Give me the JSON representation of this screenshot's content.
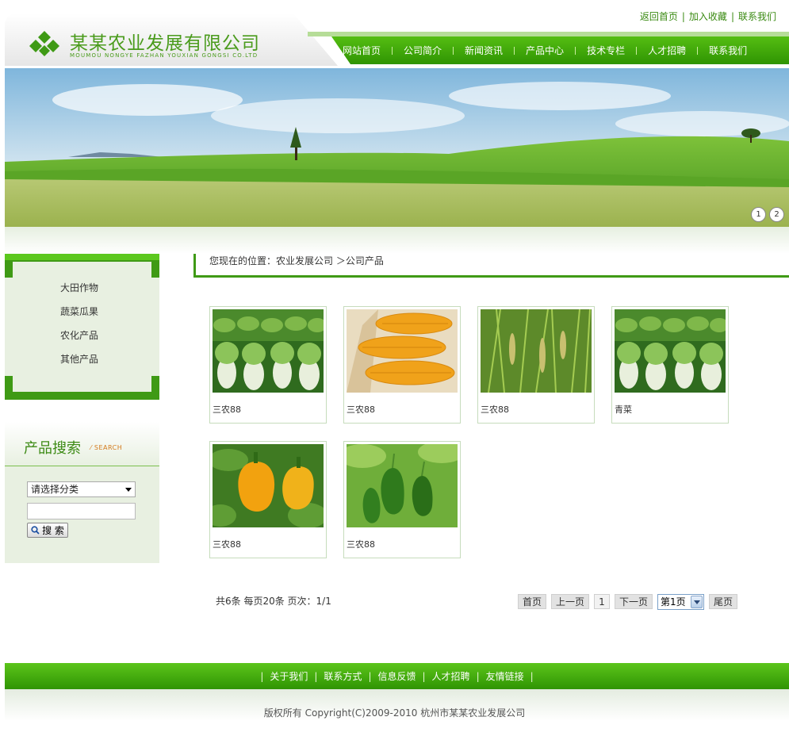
{
  "top_links": [
    "返回首页",
    "加入收藏",
    "联系我们"
  ],
  "logo": {
    "title": "某某农业发展有限公司",
    "subtitle": "MOUMOU NONGYE FAZHAN YOUXIAN GONGSI CO.LTD"
  },
  "nav": [
    "网站首页",
    "公司简介",
    "新闻资讯",
    "产品中心",
    "技术专栏",
    "人才招聘",
    "联系我们"
  ],
  "banner": {
    "dots": [
      "1",
      "2"
    ]
  },
  "sidebar": {
    "categories": [
      "大田作物",
      "蔬菜瓜果",
      "农化产品",
      "其他产品"
    ],
    "search": {
      "title": "产品搜索",
      "title_en": "SEARCH",
      "select_value": "请选择分类",
      "button_label": "搜 索"
    }
  },
  "breadcrumb": "您现在的位置：农业发展公司 ＞公司产品",
  "products": [
    {
      "name": "三农88",
      "image": "cabbage"
    },
    {
      "name": "三农88",
      "image": "corn"
    },
    {
      "name": "三农88",
      "image": "rice"
    },
    {
      "name": "青菜",
      "image": "cabbage"
    },
    {
      "name": "三农88",
      "image": "yellow-pepper"
    },
    {
      "name": "三农88",
      "image": "green-pepper"
    }
  ],
  "pager": {
    "info": "共6条  每页20条  页次：1/1",
    "first": "首页",
    "prev": "上一页",
    "current": "1",
    "next": "下一页",
    "select_value": "第1页",
    "last": "尾页"
  },
  "footer": {
    "links": [
      "关于我们",
      "联系方式",
      "信息反馈",
      "人才招聘",
      "友情链接"
    ],
    "copyright": "版权所有  Copyright(C)2009-2010 杭州市某某农业发展公司"
  },
  "colors": {
    "brand_green": "#3f9a15",
    "nav_green": "#4bb00e",
    "panel_bg": "#e8f0e1"
  }
}
